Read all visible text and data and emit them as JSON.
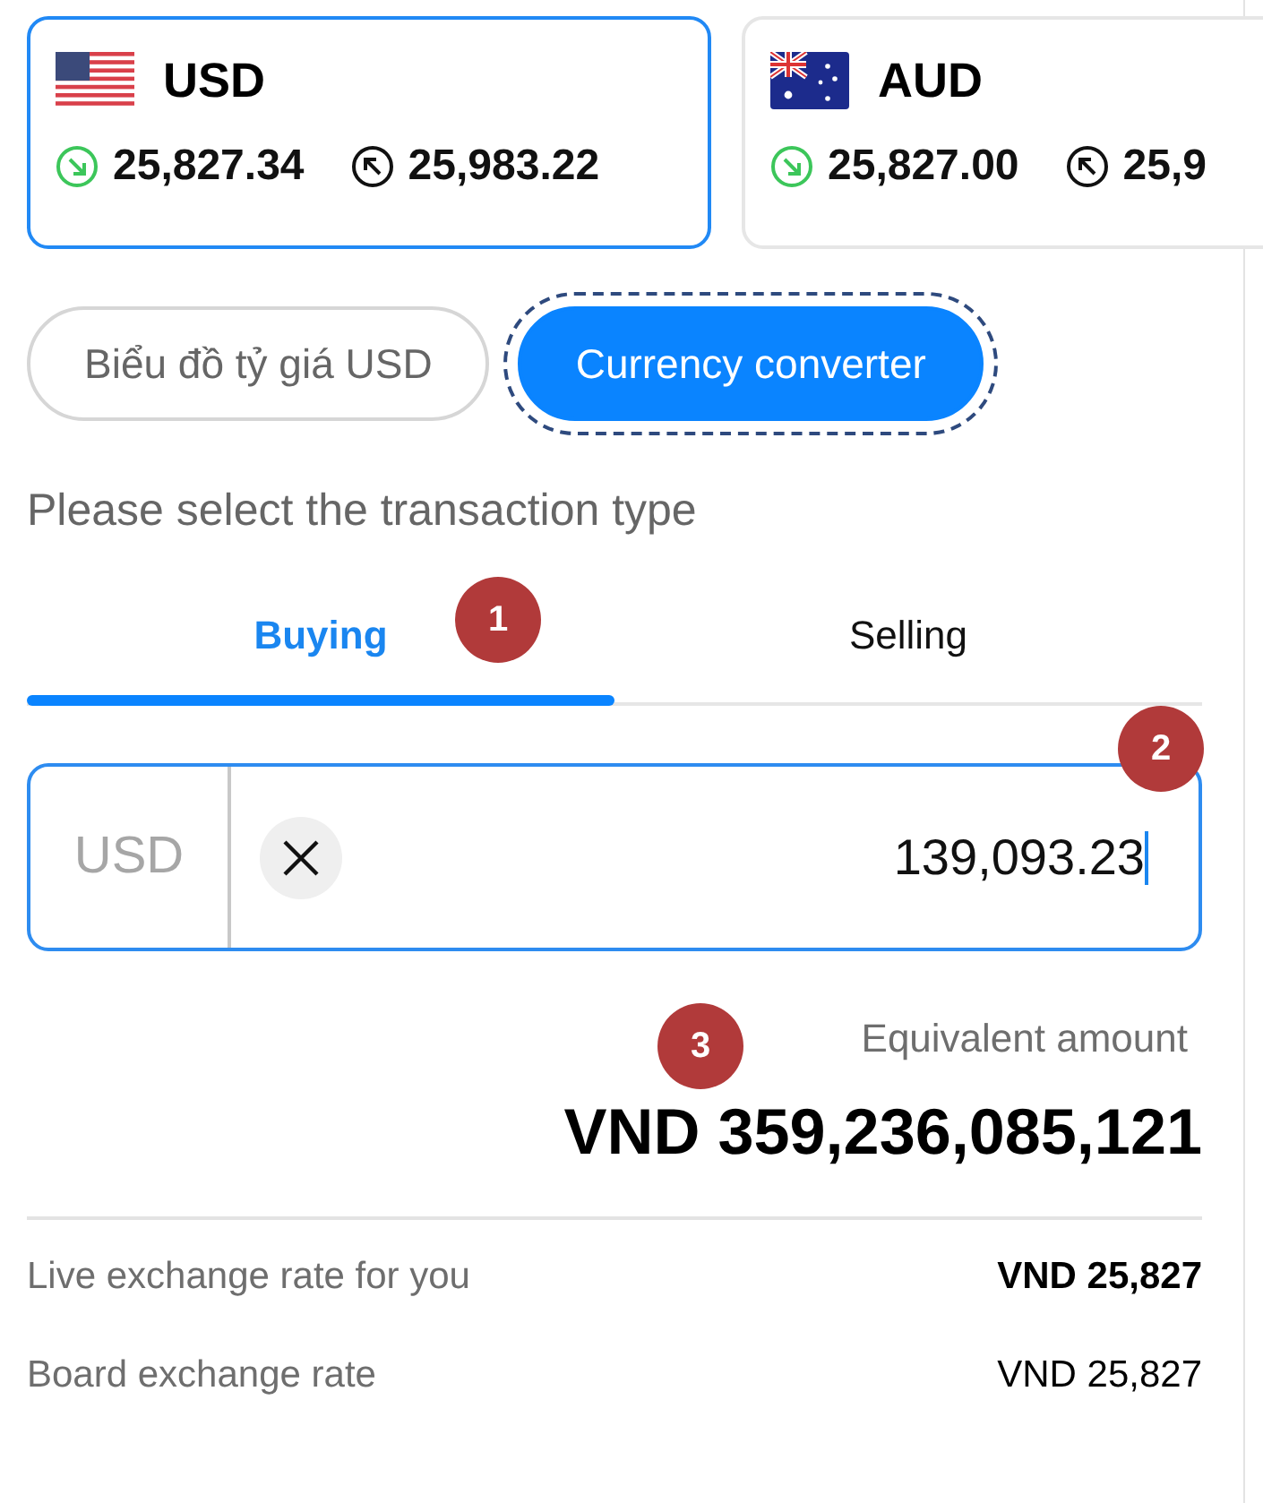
{
  "cards": [
    {
      "code": "USD",
      "kind": "us",
      "selected": true,
      "buy": "25,827.34",
      "sell": "25,983.22"
    },
    {
      "code": "AUD",
      "kind": "au",
      "selected": false,
      "buy": "25,827.00",
      "sell": "25,9"
    }
  ],
  "view_buttons": [
    {
      "label": "Biểu đồ tỷ giá USD",
      "selected": false,
      "focused": false
    },
    {
      "label": "Currency converter",
      "selected": true,
      "focused": true
    }
  ],
  "prompt": "Please select the transaction type",
  "tabs": [
    {
      "label": "Buying",
      "selected": true
    },
    {
      "label": "Selling",
      "selected": false
    }
  ],
  "amount_field": {
    "currency": "USD",
    "value": "139,093.23"
  },
  "result": {
    "label": "Equivalent amount",
    "amount": "VND 359,236,085,121"
  },
  "rates": [
    {
      "label": "Live exchange rate for you",
      "value": "VND 25,827",
      "emphasized": true
    },
    {
      "label": "Board exchange rate",
      "value": "VND 25,827",
      "emphasized": false
    }
  ],
  "markers": [
    "1",
    "2",
    "3"
  ]
}
